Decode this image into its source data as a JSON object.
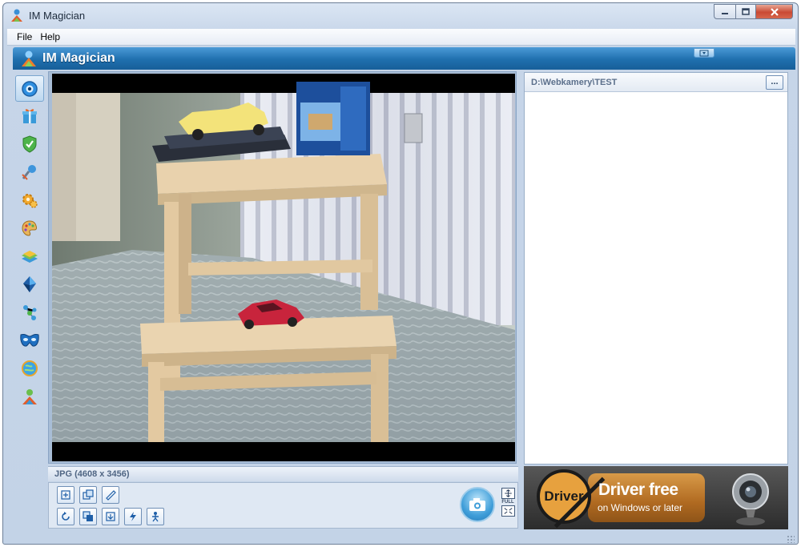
{
  "window": {
    "title": "IM Magician",
    "controls": {
      "minimize": "minimize",
      "maximize": "maximize",
      "close": "close"
    }
  },
  "menu": {
    "items": [
      {
        "label": "File"
      },
      {
        "label": "Help"
      }
    ]
  },
  "banner": {
    "title": "IM Magician"
  },
  "sidebar": {
    "items": [
      {
        "name": "webcam-icon",
        "active": true
      },
      {
        "name": "gift-icon"
      },
      {
        "name": "shield-icon"
      },
      {
        "name": "microphone-icon"
      },
      {
        "name": "settings-icon"
      },
      {
        "name": "palette-icon"
      },
      {
        "name": "layers-icon"
      },
      {
        "name": "crystal-icon"
      },
      {
        "name": "network-icon"
      },
      {
        "name": "mask-icon"
      },
      {
        "name": "globe-icon"
      },
      {
        "name": "users-icon"
      }
    ]
  },
  "preview": {
    "info": "JPG (4608 x 3456)"
  },
  "toolbar": {
    "row1": [
      "fit-icon",
      "crop-icon",
      "ruler-icon"
    ],
    "row2": [
      "rotate-icon",
      "copy-icon",
      "export-icon",
      "flash-icon",
      "person-icon"
    ],
    "full_label": "FULL"
  },
  "files": {
    "path": "D:\\Webkamery\\TEST",
    "browse_label": "..."
  },
  "ad": {
    "circle_text": "Driver",
    "title": "Driver free",
    "subtitle": "on Windows or later"
  },
  "colors": {
    "banner_top": "#4b9ad7",
    "banner_bottom": "#175f99",
    "ad_accent": "#b06a21"
  }
}
